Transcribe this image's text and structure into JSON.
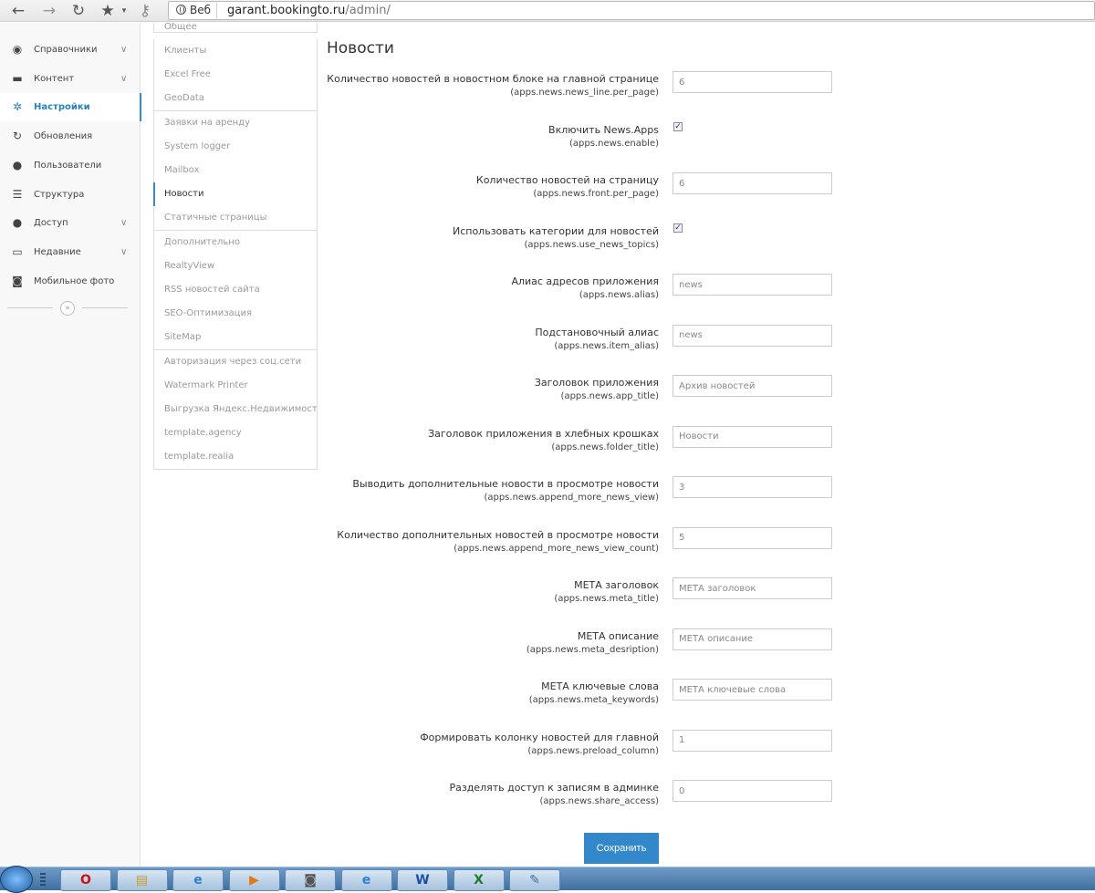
{
  "browser": {
    "back_icon": "←",
    "forward_icon": "→",
    "reload_icon": "↻",
    "star_icon": "★",
    "key_icon": "⚷",
    "chip_label": "Веб",
    "url_host": "garant.bookingto.ru",
    "url_path": "/admin/"
  },
  "sidebar": {
    "items": [
      {
        "label": "Справочники",
        "icon": "globe-icon",
        "glyph": "◉",
        "has_chevron": true
      },
      {
        "label": "Контент",
        "icon": "monitor-icon",
        "glyph": "▬",
        "has_chevron": true
      },
      {
        "label": "Настройки",
        "icon": "gear-icon",
        "glyph": "✲",
        "has_chevron": false,
        "active": true
      },
      {
        "label": "Обновления",
        "icon": "refresh-icon",
        "glyph": "↻",
        "has_chevron": false
      },
      {
        "label": "Пользователи",
        "icon": "user-icon",
        "glyph": "●",
        "has_chevron": false
      },
      {
        "label": "Структура",
        "icon": "list-icon",
        "glyph": "☰",
        "has_chevron": false
      },
      {
        "label": "Доступ",
        "icon": "users-icon",
        "glyph": "●",
        "has_chevron": true
      },
      {
        "label": "Недавние",
        "icon": "desktop-icon",
        "glyph": "▭",
        "has_chevron": true
      },
      {
        "label": "Мобильное фото",
        "icon": "camera-icon",
        "glyph": "◙",
        "has_chevron": false
      }
    ],
    "chevron": "∨",
    "collapse_glyph": "«"
  },
  "submenu": {
    "items": [
      {
        "label": "Общее"
      },
      {
        "label": "Клиенты"
      },
      {
        "label": "Excel Free"
      },
      {
        "label": "GeoData"
      },
      {
        "label": "Заявки на аренду"
      },
      {
        "label": "System logger"
      },
      {
        "label": "Mailbox"
      },
      {
        "label": "Новости",
        "active": true
      },
      {
        "label": "Статичные страницы"
      },
      {
        "label": "Дополнительно"
      },
      {
        "label": "RealtyView"
      },
      {
        "label": "RSS новостей сайта"
      },
      {
        "label": "SEO-Оптимизация"
      },
      {
        "label": "SiteMap"
      },
      {
        "label": "Авторизация через соц.сети"
      },
      {
        "label": "Watermark Printer"
      },
      {
        "label": "Выгрузка Яндекс.Недвижимость"
      },
      {
        "label": "template.agency"
      },
      {
        "label": "template.realia"
      }
    ]
  },
  "main": {
    "title": "Новости",
    "fields": [
      {
        "label": "Количество новостей в новостном блоке на главной странице",
        "key": "(apps.news.news_line.per_page)",
        "type": "text",
        "value": "6"
      },
      {
        "label": "Включить News.Apps",
        "key": "(apps.news.enable)",
        "type": "checkbox",
        "checked": true
      },
      {
        "label": "Количество новостей на страницу",
        "key": "(apps.news.front.per_page)",
        "type": "text",
        "value": "6"
      },
      {
        "label": "Использовать категории для новостей",
        "key": "(apps.news.use_news_topics)",
        "type": "checkbox",
        "checked": true
      },
      {
        "label": "Алиас адресов приложения",
        "key": "(apps.news.alias)",
        "type": "text",
        "value": "news"
      },
      {
        "label": "Подстановочный алиас",
        "key": "(apps.news.item_alias)",
        "type": "text",
        "value": "news"
      },
      {
        "label": "Заголовок приложения",
        "key": "(apps.news.app_title)",
        "type": "text",
        "value": "Архив новостей"
      },
      {
        "label": "Заголовок приложения в хлебных крошках",
        "key": "(apps.news.folder_title)",
        "type": "text",
        "value": "Новости"
      },
      {
        "label": "Выводить дополнительные новости в просмотре новости",
        "key": "(apps.news.append_more_news_view)",
        "type": "text",
        "value": "3"
      },
      {
        "label": "Количество дополнительных новостей в просмотре новости",
        "key": "(apps.news.append_more_news_view_count)",
        "type": "text",
        "value": "5"
      },
      {
        "label": "МЕТА заголовок",
        "key": "(apps.news.meta_title)",
        "type": "text",
        "value": "МЕТА заголовок"
      },
      {
        "label": "МЕТА описание",
        "key": "(apps.news.meta_desription)",
        "type": "text",
        "value": "МЕТА описание"
      },
      {
        "label": "МЕТА ключевые слова",
        "key": "(apps.news.meta_keywords)",
        "type": "text",
        "value": "МЕТА ключевые слова"
      },
      {
        "label": "Формировать колонку новостей для главной",
        "key": "(apps.news.preload_column)",
        "type": "text",
        "value": "1"
      },
      {
        "label": "Разделять доступ к записям в админке",
        "key": "(apps.news.share_access)",
        "type": "text",
        "value": "0"
      }
    ],
    "save_label": "Сохранить"
  },
  "taskbar": {
    "apps": [
      {
        "name": "opera-task",
        "glyph": "O",
        "color": "#cc1111"
      },
      {
        "name": "explorer-task",
        "glyph": "▤",
        "color": "#c89a2a"
      },
      {
        "name": "ie-task",
        "glyph": "e",
        "color": "#2b7fd6"
      },
      {
        "name": "media-player-task",
        "glyph": "▶",
        "color": "#e07a10"
      },
      {
        "name": "camera-task",
        "glyph": "◙",
        "color": "#555555"
      },
      {
        "name": "ie2-task",
        "glyph": "e",
        "color": "#2b7fd6"
      },
      {
        "name": "word-task",
        "glyph": "W",
        "color": "#1f4fa0"
      },
      {
        "name": "excel-task",
        "glyph": "X",
        "color": "#1e7a2e"
      },
      {
        "name": "notepad-task",
        "glyph": "✎",
        "color": "#3a6ea5"
      }
    ]
  }
}
